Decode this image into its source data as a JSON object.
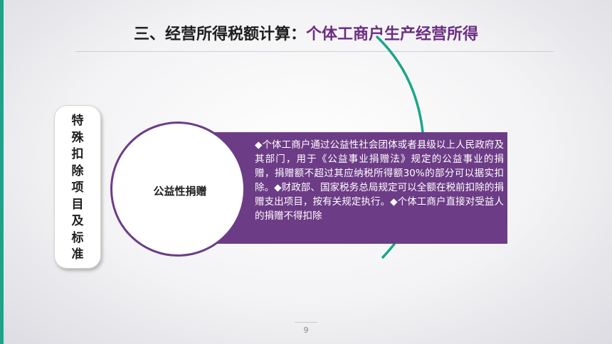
{
  "slide": {
    "title_prefix": "三、经营所得税额计算：",
    "title_highlight": "个体工商户生产经营所得",
    "side_chars": [
      "特",
      "殊",
      "扣",
      "除",
      "项",
      "目",
      "及",
      "标",
      "准"
    ],
    "circle_label": "公益性捐赠",
    "body_text": "◆个体工商户通过公益性社会团体或者县级以上人民政府及其部门，用于《公益事业捐赠法》规定的公益事业的捐赠，捐赠额不超过其应纳税所得额30%的部分可以据实扣除。◆财政部、国家税务总局规定可以全额在税前扣除的捐赠支出项目，按有关规定执行。◆个体工商户直接对受益人的捐赠不得扣除",
    "page_number": "9"
  },
  "colors": {
    "accent_green": "#1aa58a",
    "accent_purple": "#6d3c86",
    "title_highlight": "#6c2d82"
  }
}
